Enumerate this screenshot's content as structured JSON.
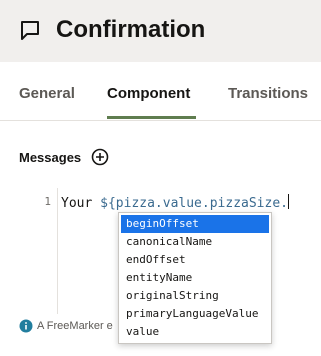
{
  "header": {
    "title": "Confirmation"
  },
  "tabs": [
    {
      "label": "General"
    },
    {
      "label": "Component"
    },
    {
      "label": "Transitions"
    }
  ],
  "messages": {
    "label": "Messages"
  },
  "editor": {
    "line_number": "1",
    "code_prefix": "Your ",
    "code_expression": "${pizza.value.pizzaSize."
  },
  "autocomplete": {
    "items": [
      "beginOffset",
      "canonicalName",
      "endOffset",
      "entityName",
      "originalString",
      "primaryLanguageValue",
      "value"
    ],
    "selected_index": 0
  },
  "info": {
    "text": "A FreeMarker e"
  },
  "colors": {
    "header_bg": "#f1efed",
    "accent_underline": "#5f7d4f",
    "selection": "#1a73e8",
    "info_icon": "#227e9e"
  },
  "icons": {
    "header": "chat-bubble-icon",
    "add": "add-circle-icon",
    "info": "info-icon"
  }
}
